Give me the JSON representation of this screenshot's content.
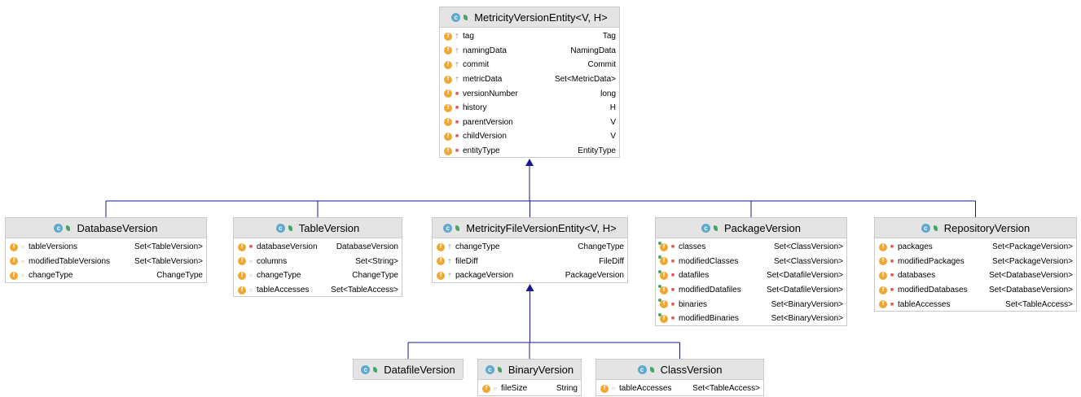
{
  "colors": {
    "edge": "#1a1a8c",
    "header_bg": "#e4e4e4",
    "field_icon": "#f0a732",
    "class_icon": "#5fa8cf",
    "private": "#d9534f"
  },
  "classes": [
    {
      "id": "metricity",
      "name": "MetricityVersionEntity<V, H>",
      "fields": [
        {
          "name": "tag",
          "type": "Tag",
          "vis": "protected"
        },
        {
          "name": "namingData",
          "type": "NamingData",
          "vis": "protected"
        },
        {
          "name": "commit",
          "type": "Commit",
          "vis": "protected"
        },
        {
          "name": "metricData",
          "type": "Set<MetricData>",
          "vis": "protected"
        },
        {
          "name": "versionNumber",
          "type": "long",
          "vis": "private"
        },
        {
          "name": "history",
          "type": "H",
          "vis": "private"
        },
        {
          "name": "parentVersion",
          "type": "V",
          "vis": "private"
        },
        {
          "name": "childVersion",
          "type": "V",
          "vis": "private"
        },
        {
          "name": "entityType",
          "type": "EntityType",
          "vis": "private"
        }
      ]
    },
    {
      "id": "database",
      "name": "DatabaseVersion",
      "fields": [
        {
          "name": "tableVersions",
          "type": "Set<TableVersion>",
          "vis": "package"
        },
        {
          "name": "modifiedTableVersions",
          "type": "Set<TableVersion>",
          "vis": "package"
        },
        {
          "name": "changeType",
          "type": "ChangeType",
          "vis": "package"
        }
      ]
    },
    {
      "id": "table",
      "name": "TableVersion",
      "fields": [
        {
          "name": "databaseVersion",
          "type": "DatabaseVersion",
          "vis": "private"
        },
        {
          "name": "columns",
          "type": "Set<String>",
          "vis": "package"
        },
        {
          "name": "changeType",
          "type": "ChangeType",
          "vis": "package"
        },
        {
          "name": "tableAccesses",
          "type": "Set<TableAccess>",
          "vis": "package"
        }
      ]
    },
    {
      "id": "metricityfile",
      "name": "MetricityFileVersionEntity<V, H>",
      "fields": [
        {
          "name": "changeType",
          "type": "ChangeType",
          "vis": "protected"
        },
        {
          "name": "fileDiff",
          "type": "FileDiff",
          "vis": "protected"
        },
        {
          "name": "packageVersion",
          "type": "PackageVersion",
          "vis": "protected"
        }
      ]
    },
    {
      "id": "package",
      "name": "PackageVersion",
      "fields": [
        {
          "name": "classes",
          "type": "Set<ClassVersion>",
          "vis": "private",
          "pin": true
        },
        {
          "name": "modifiedClasses",
          "type": "Set<ClassVersion>",
          "vis": "private",
          "pin": true
        },
        {
          "name": "datafiles",
          "type": "Set<DatafileVersion>",
          "vis": "private",
          "pin": true
        },
        {
          "name": "modifiedDatafiles",
          "type": "Set<DatafileVersion>",
          "vis": "private",
          "pin": true
        },
        {
          "name": "binaries",
          "type": "Set<BinaryVersion>",
          "vis": "private",
          "pin": true
        },
        {
          "name": "modifiedBinaries",
          "type": "Set<BinaryVersion>",
          "vis": "private",
          "pin": true
        }
      ]
    },
    {
      "id": "repository",
      "name": "RepositoryVersion",
      "fields": [
        {
          "name": "packages",
          "type": "Set<PackageVersion>",
          "vis": "private"
        },
        {
          "name": "modifiedPackages",
          "type": "Set<PackageVersion>",
          "vis": "private"
        },
        {
          "name": "databases",
          "type": "Set<DatabaseVersion>",
          "vis": "private"
        },
        {
          "name": "modifiedDatabases",
          "type": "Set<DatabaseVersion>",
          "vis": "private"
        },
        {
          "name": "tableAccesses",
          "type": "Set<TableAccess>",
          "vis": "private"
        }
      ]
    },
    {
      "id": "datafile",
      "name": "DatafileVersion",
      "fields": []
    },
    {
      "id": "binary",
      "name": "BinaryVersion",
      "fields": [
        {
          "name": "fileSize",
          "type": "String",
          "vis": "package"
        }
      ]
    },
    {
      "id": "classversion",
      "name": "ClassVersion",
      "fields": [
        {
          "name": "tableAccesses",
          "type": "Set<TableAccess>",
          "vis": "package"
        }
      ]
    }
  ],
  "edges": [
    {
      "from": "database",
      "to": "metricity"
    },
    {
      "from": "table",
      "to": "metricity"
    },
    {
      "from": "metricityfile",
      "to": "metricity"
    },
    {
      "from": "package",
      "to": "metricity"
    },
    {
      "from": "repository",
      "to": "metricity"
    },
    {
      "from": "datafile",
      "to": "metricityfile"
    },
    {
      "from": "binary",
      "to": "metricityfile"
    },
    {
      "from": "classversion",
      "to": "metricityfile"
    }
  ]
}
